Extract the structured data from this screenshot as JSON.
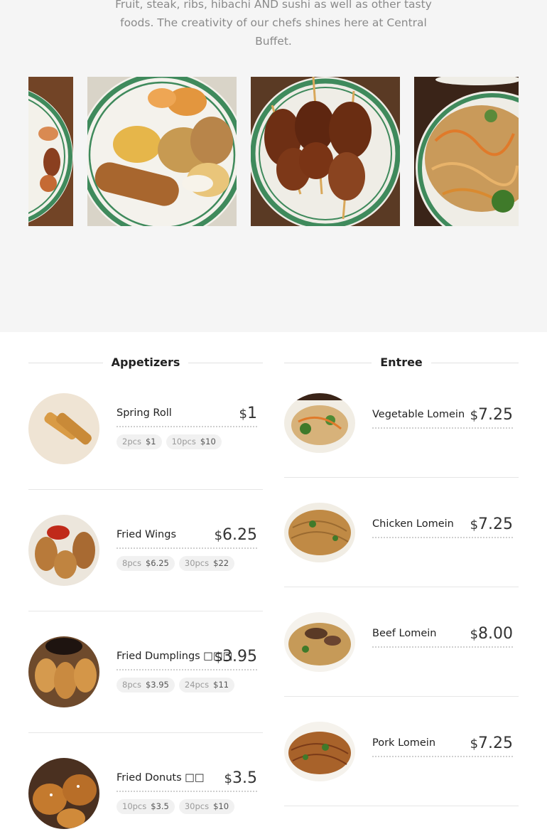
{
  "hero": {
    "description": "Fruit, steak, ribs, hibachi AND sushi as well as other tasty foods. The creativity of our chefs shines here at Central Buffet."
  },
  "carousel": {
    "slides": [
      "shrimp-plate-image",
      "fried-platter-image",
      "chicken-skewers-image",
      "lo-mein-plate-image"
    ]
  },
  "appetizers": {
    "title": "Appetizers",
    "items": [
      {
        "name": "Spring Roll",
        "currency": "$",
        "price": "1",
        "options": [
          {
            "qty": "2pcs",
            "price": "$1"
          },
          {
            "qty": "10pcs",
            "price": "$10"
          }
        ]
      },
      {
        "name": "Fried Wings",
        "currency": "$",
        "price": "6.25",
        "options": [
          {
            "qty": "8pcs",
            "price": "$6.25"
          },
          {
            "qty": "30pcs",
            "price": "$22"
          }
        ]
      },
      {
        "name": "Fried Dumplings □□□",
        "currency": "$",
        "price": "3.95",
        "options": [
          {
            "qty": "8pcs",
            "price": "$3.95"
          },
          {
            "qty": "24pcs",
            "price": "$11"
          }
        ]
      },
      {
        "name": "Fried Donuts □□",
        "currency": "$",
        "price": "3.5",
        "options": [
          {
            "qty": "10pcs",
            "price": "$3.5"
          },
          {
            "qty": "30pcs",
            "price": "$10"
          }
        ]
      }
    ]
  },
  "entree": {
    "title": "Entree",
    "items": [
      {
        "name": "Vegetable Lomein",
        "currency": "$",
        "price": "7.25"
      },
      {
        "name": "Chicken Lomein",
        "currency": "$",
        "price": "7.25"
      },
      {
        "name": "Beef Lomein",
        "currency": "$",
        "price": "8.00"
      },
      {
        "name": "Pork Lomein",
        "currency": "$",
        "price": "7.25"
      }
    ]
  },
  "colors": {
    "hero_bg": "#f5f5f5",
    "divider": "#e6e6e6",
    "plate_rim": "#3f8a5c"
  }
}
